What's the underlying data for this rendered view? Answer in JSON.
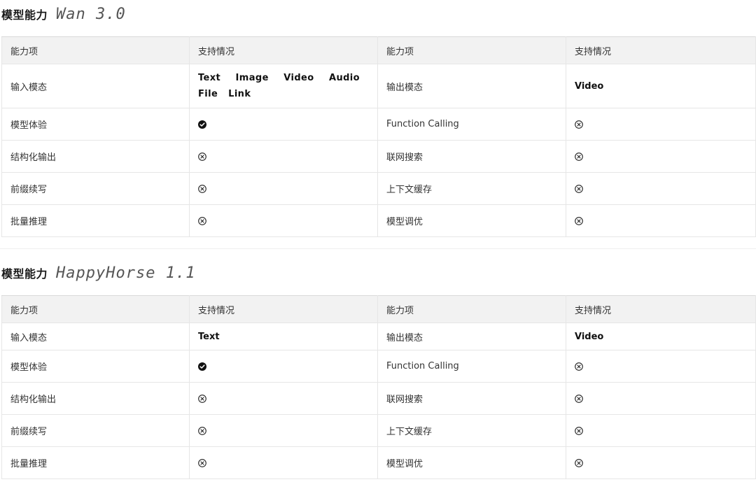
{
  "sections": [
    {
      "label": "模型能力",
      "model": "Wan 3.0",
      "headers": [
        "能力项",
        "支持情况",
        "能力项",
        "支持情况"
      ],
      "input_row": {
        "cap_left": "输入模态",
        "val_left": "Text Image Video Audio File Link",
        "cap_right": "输出模态",
        "val_right": "Video"
      },
      "rows": [
        {
          "cap_left": "模型体验",
          "val_left": "check",
          "cap_right": "Function Calling",
          "val_right": "cross"
        },
        {
          "cap_left": "结构化输出",
          "val_left": "cross",
          "cap_right": "联网搜索",
          "val_right": "cross"
        },
        {
          "cap_left": "前缀续写",
          "val_left": "cross",
          "cap_right": "上下文缓存",
          "val_right": "cross"
        },
        {
          "cap_left": "批量推理",
          "val_left": "cross",
          "cap_right": "模型调优",
          "val_right": "cross"
        }
      ]
    },
    {
      "label": "模型能力",
      "model": "HappyHorse 1.1",
      "headers": [
        "能力项",
        "支持情况",
        "能力项",
        "支持情况"
      ],
      "input_row": {
        "cap_left": "输入模态",
        "val_left": "Text",
        "cap_right": "输出模态",
        "val_right": "Video"
      },
      "rows": [
        {
          "cap_left": "模型体验",
          "val_left": "check",
          "cap_right": "Function Calling",
          "val_right": "cross"
        },
        {
          "cap_left": "结构化输出",
          "val_left": "cross",
          "cap_right": "联网搜索",
          "val_right": "cross"
        },
        {
          "cap_left": "前缀续写",
          "val_left": "cross",
          "cap_right": "上下文缓存",
          "val_right": "cross"
        },
        {
          "cap_left": "批量推理",
          "val_left": "cross",
          "cap_right": "模型调优",
          "val_right": "cross"
        }
      ]
    }
  ],
  "icons": {
    "check": "check-circle-icon",
    "cross": "cross-circle-icon"
  },
  "colors": {
    "header_bg": "#f2f2f2",
    "border": "#e6e6e6",
    "text": "#333333"
  }
}
